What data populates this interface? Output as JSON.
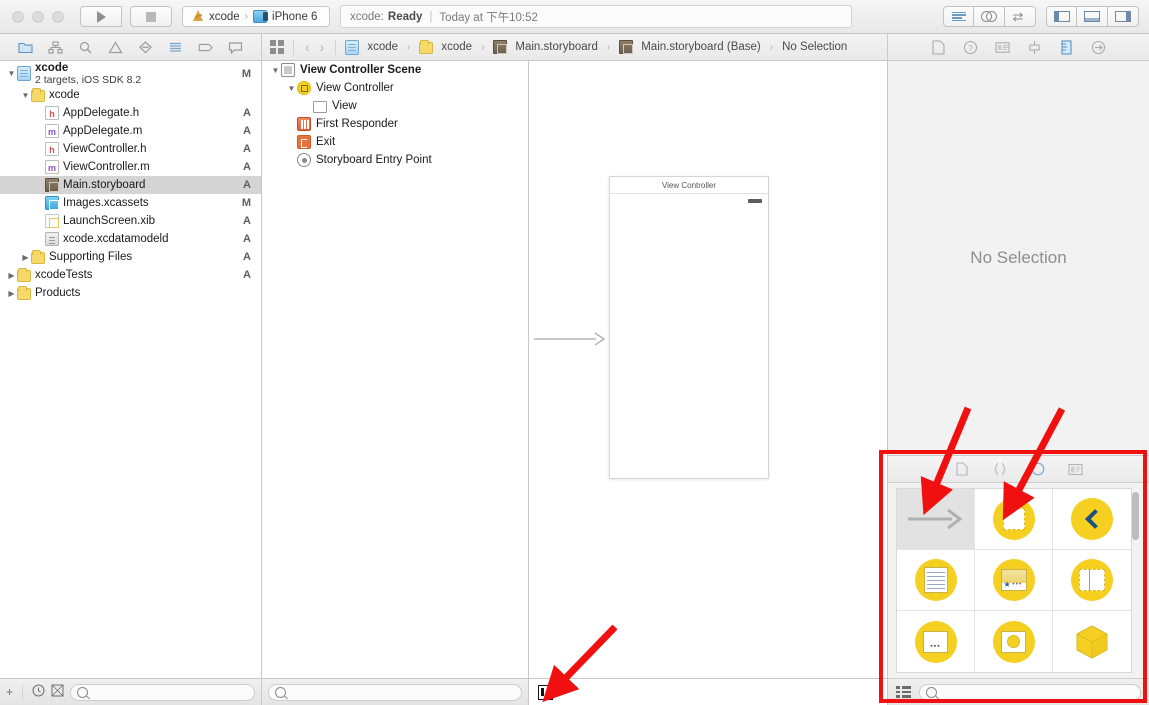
{
  "window": {
    "traffic_lights": [
      "close",
      "minimize",
      "zoom"
    ]
  },
  "toolbar": {
    "run_label": "Run",
    "stop_label": "Stop",
    "scheme": {
      "project": "xcode",
      "separator": "›",
      "destination": "iPhone 6"
    },
    "status": {
      "prefix": "xcode:",
      "state": "Ready",
      "divider": "|",
      "time": "Today at 下午10:52"
    },
    "editor_modes": [
      "standard-editor",
      "assistant-editor",
      "version-editor"
    ],
    "view_toggles": [
      "navigator-toggle",
      "debug-area-toggle",
      "utilities-toggle"
    ]
  },
  "navigator": {
    "tabs": [
      "project-navigator",
      "symbol-navigator",
      "find-navigator",
      "issue-navigator",
      "test-navigator",
      "debug-navigator",
      "breakpoint-navigator",
      "report-navigator"
    ],
    "active_tab": "project-navigator",
    "tree": [
      {
        "label": "xcode",
        "sub": "2 targets, iOS SDK 8.2",
        "badge": "M",
        "icon": "project-icon",
        "indent": 0,
        "twisty": "▼",
        "bold": true
      },
      {
        "label": "xcode",
        "badge": "",
        "icon": "folder-icon",
        "indent": 1,
        "twisty": "▼",
        "bold": false
      },
      {
        "label": "AppDelegate.h",
        "badge": "A",
        "icon": "header-file-icon",
        "indent": 2,
        "twisty": "",
        "bold": false
      },
      {
        "label": "AppDelegate.m",
        "badge": "A",
        "icon": "implementation-file-icon",
        "indent": 2,
        "twisty": "",
        "bold": false
      },
      {
        "label": "ViewController.h",
        "badge": "A",
        "icon": "header-file-icon",
        "indent": 2,
        "twisty": "",
        "bold": false
      },
      {
        "label": "ViewController.m",
        "badge": "A",
        "icon": "implementation-file-icon",
        "indent": 2,
        "twisty": "",
        "bold": false
      },
      {
        "label": "Main.storyboard",
        "badge": "A",
        "icon": "storyboard-icon",
        "indent": 2,
        "twisty": "",
        "bold": false,
        "selected": true
      },
      {
        "label": "Images.xcassets",
        "badge": "M",
        "icon": "asset-catalog-icon",
        "indent": 2,
        "twisty": "",
        "bold": false
      },
      {
        "label": "LaunchScreen.xib",
        "badge": "A",
        "icon": "xib-icon",
        "indent": 2,
        "twisty": "",
        "bold": false
      },
      {
        "label": "xcode.xcdatamodeld",
        "badge": "A",
        "icon": "datamodel-icon",
        "indent": 2,
        "twisty": "",
        "bold": false
      },
      {
        "label": "Supporting Files",
        "badge": "A",
        "icon": "folder-icon",
        "indent": 1,
        "twisty": "▶",
        "bold": false
      },
      {
        "label": "xcodeTests",
        "badge": "A",
        "icon": "folder-icon",
        "indent": 0,
        "twisty": "▶",
        "bold": false
      },
      {
        "label": "Products",
        "badge": "",
        "icon": "folder-icon",
        "indent": 0,
        "twisty": "▶",
        "bold": false
      }
    ],
    "filter_placeholder": ""
  },
  "jumpbar": {
    "back_label": "‹",
    "forward_label": "›",
    "breadcrumb": [
      {
        "label": "xcode",
        "icon": "project-icon"
      },
      {
        "label": "xcode",
        "icon": "folder-icon"
      },
      {
        "label": "Main.storyboard",
        "icon": "storyboard-icon"
      },
      {
        "label": "Main.storyboard (Base)",
        "icon": "storyboard-icon"
      },
      {
        "label": "No Selection",
        "icon": ""
      }
    ],
    "separator": "›"
  },
  "outline": {
    "rows": [
      {
        "label": "View Controller Scene",
        "icon": "scene-icon",
        "indent": 0,
        "twisty": "▼",
        "bold": true
      },
      {
        "label": "View Controller",
        "icon": "view-controller-icon",
        "indent": 1,
        "twisty": "▼",
        "bold": false
      },
      {
        "label": "View",
        "icon": "view-icon",
        "indent": 2,
        "twisty": "",
        "bold": false
      },
      {
        "label": "First Responder",
        "icon": "first-responder-icon",
        "indent": 1,
        "twisty": "",
        "bold": false
      },
      {
        "label": "Exit",
        "icon": "exit-icon",
        "indent": 1,
        "twisty": "",
        "bold": false
      },
      {
        "label": "Storyboard Entry Point",
        "icon": "entry-point-icon",
        "indent": 1,
        "twisty": "",
        "bold": false
      }
    ],
    "filter_placeholder": ""
  },
  "canvas": {
    "scene_title": "View Controller",
    "zoom_control": "zoom-indicator"
  },
  "inspector": {
    "tabs": [
      "file-inspector",
      "quick-help-inspector",
      "identity-inspector",
      "attributes-inspector",
      "size-inspector",
      "connections-inspector"
    ],
    "active_tab": "size-inspector",
    "empty_message": "No Selection"
  },
  "library": {
    "tabs": [
      "file-template-library",
      "code-snippet-library",
      "object-library",
      "media-library"
    ],
    "active_tab": "object-library",
    "items": [
      {
        "name": "segue-arrow",
        "icon": "arrow-right-icon",
        "selected": true
      },
      {
        "name": "view-controller",
        "icon": "dashed-square-icon",
        "selected": false
      },
      {
        "name": "navigation-controller",
        "icon": "chevron-left-icon",
        "selected": false
      },
      {
        "name": "table-view-controller",
        "icon": "table-lines-icon",
        "selected": false
      },
      {
        "name": "tab-bar-controller",
        "icon": "tab-bar-icon",
        "selected": false
      },
      {
        "name": "split-view-controller",
        "icon": "split-view-icon",
        "selected": false
      },
      {
        "name": "page-view-controller",
        "icon": "page-control-icon",
        "selected": false
      },
      {
        "name": "glkit-view-controller",
        "icon": "glkit-icon",
        "selected": false
      },
      {
        "name": "object",
        "icon": "cube-icon",
        "selected": false
      }
    ],
    "filter_placeholder": ""
  },
  "annotations": {
    "highlight_color": "#f01010",
    "arrows": [
      "library-selected-item-arrow",
      "library-view-controller-arrow",
      "canvas-zoom-arrow"
    ]
  }
}
